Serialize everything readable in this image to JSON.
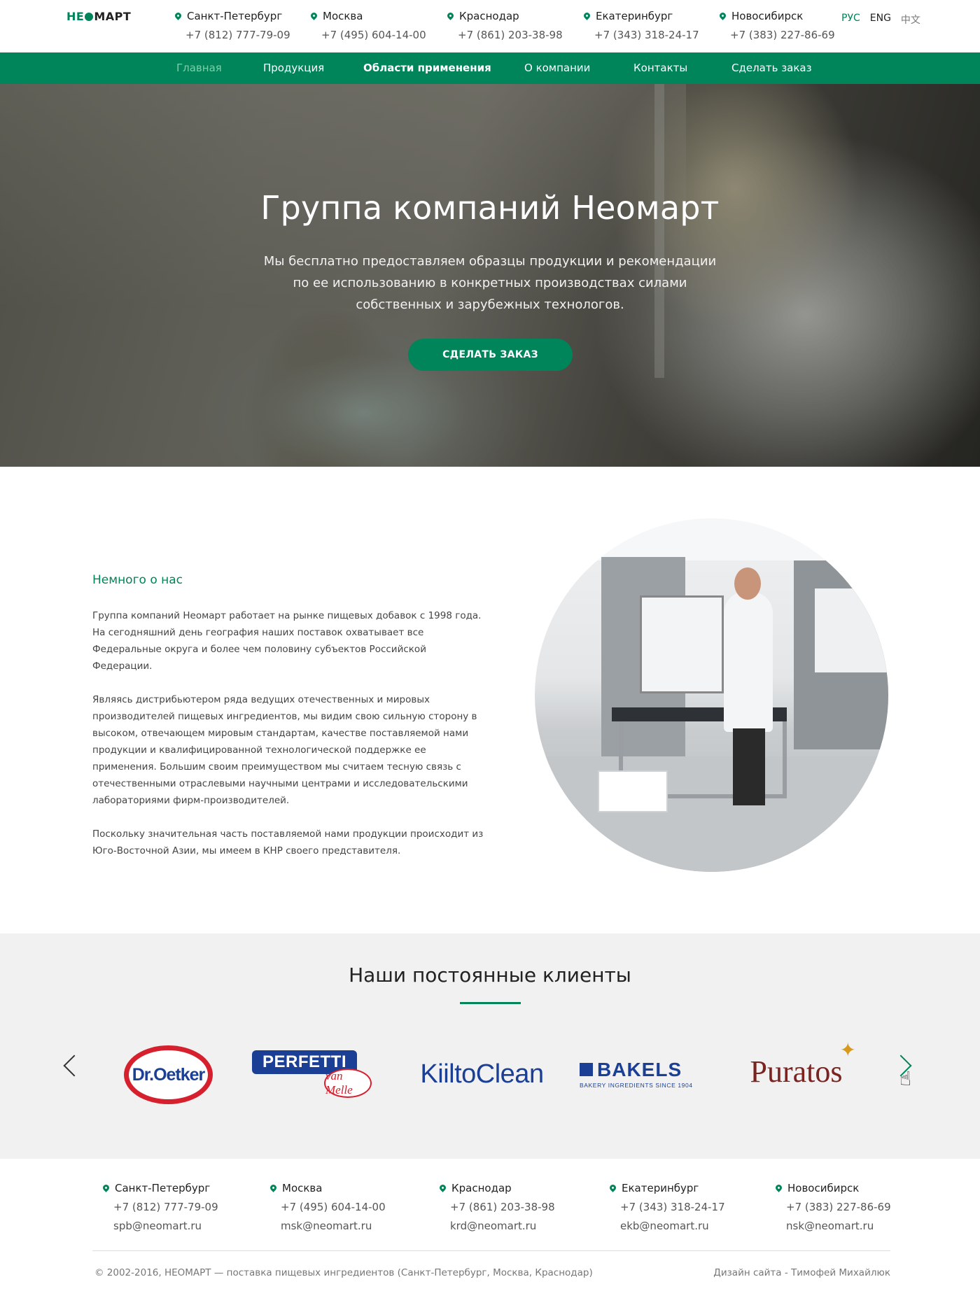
{
  "header": {
    "logo": {
      "he": "НЕ",
      "rest": "МАРТ"
    },
    "offices": [
      {
        "city": "Санкт-Петербург",
        "phone": "+7 (812) 777-79-09"
      },
      {
        "city": "Москва",
        "phone": "+7 (495) 604-14-00"
      },
      {
        "city": "Краснодар",
        "phone": "+7 (861) 203-38-98"
      },
      {
        "city": "Екатеринбург",
        "phone": "+7 (343) 318-24-17"
      },
      {
        "city": "Новосибирск",
        "phone": "+7 (383) 227-86-69"
      }
    ],
    "languages": [
      {
        "label": "РУС",
        "state": "active"
      },
      {
        "label": "ENG",
        "state": "normal"
      },
      {
        "label": "中文",
        "state": "muted"
      }
    ]
  },
  "nav": {
    "items": [
      {
        "label": "Главная",
        "state": "current"
      },
      {
        "label": "Продукция",
        "state": "normal"
      },
      {
        "label": "Области применения",
        "state": "bold"
      },
      {
        "label": "О компании",
        "state": "normal"
      },
      {
        "label": "Контакты",
        "state": "normal"
      },
      {
        "label": "Сделать заказ",
        "state": "normal"
      }
    ]
  },
  "hero": {
    "title": "Группа компаний Неомарт",
    "text": "Мы бесплатно предоставляем образцы продукции и рекомендации по ее использованию в конкретных производствах силами собственных и зарубежных технологов.",
    "button": "СДЕЛАТЬ ЗАКАЗ"
  },
  "about": {
    "title": "Немного о нас",
    "paragraphs": [
      "Группа компаний Неомарт работает на рынке пищевых добавок с 1998 года. На сегодняшний день география наших поставок охватывает все Федеральные округа и более чем половину субъектов Российской Федерации.",
      "Являясь дистрибьютером ряда ведущих отечественных и мировых производителей пищевых ингредиентов, мы видим свою сильную сторону в высоком, отвечающем мировым стандартам, качестве поставляемой нами продукции и квалифицированной технологической поддержке ее применения. Большим своим преимуществом мы считаем тесную связь с отечественными отраслевыми научными центрами и исследовательскими лабораториями фирм-производителей.",
      "Поскольку значительная часть поставляемой нами продукции происходит из Юго-Восточной Азии, мы имеем в КНР своего представителя."
    ]
  },
  "clients": {
    "title": "Наши постоянные клиенты",
    "logos": {
      "oetker": "Dr.Oetker",
      "perfetti_top": "PERFETTI",
      "perfetti_bottom": "van Melle",
      "kiilto": "KiiltoClean",
      "bakels": "BAKELS",
      "bakels_sub": "BAKERY INGREDIENTS SINCE 1904",
      "puratos": "Puratos"
    },
    "icons": {
      "prev": "chevron-left-icon",
      "next": "chevron-right-icon",
      "cursor": "hand-cursor-icon"
    }
  },
  "footer": {
    "offices": [
      {
        "city": "Санкт-Петербург",
        "phone": "+7 (812) 777-79-09",
        "email": "spb@neomart.ru"
      },
      {
        "city": "Москва",
        "phone": "+7 (495) 604-14-00",
        "email": "msk@neomart.ru"
      },
      {
        "city": "Краснодар",
        "phone": "+7 (861) 203-38-98",
        "email": "krd@neomart.ru"
      },
      {
        "city": "Екатеринбург",
        "phone": "+7 (343) 318-24-17",
        "email": "ekb@neomart.ru"
      },
      {
        "city": "Новосибирск",
        "phone": "+7 (383) 227-86-69",
        "email": "nsk@neomart.ru"
      }
    ],
    "copyright": "© 2002-2016, НЕОМАРТ — поставка пищевых  ингредиентов (Санкт-Петербург, Москва, Краснодар)",
    "design_credit": "Дизайн сайта - Тимофей Михайлюк"
  },
  "colors": {
    "brand_green": "#00845a",
    "nav_current": "#7ad0a9",
    "client_bg": "#f1f1f1"
  }
}
